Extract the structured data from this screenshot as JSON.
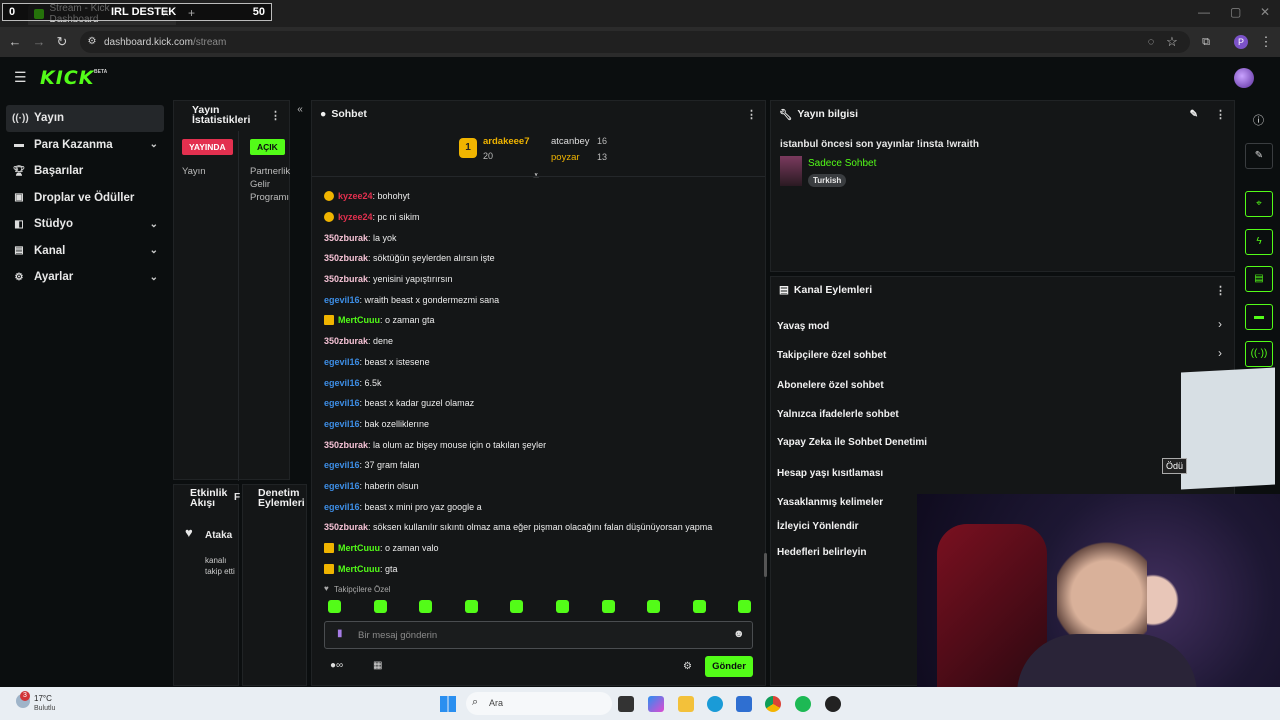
{
  "browser": {
    "tab_title": "Stream - Kick Dashboard",
    "url_domain": "dashboard.kick.com",
    "url_path": "/stream",
    "overlay_left": "0",
    "overlay_title": "IRL DESTEK",
    "overlay_count": "50",
    "profile_initial": "P"
  },
  "sidebar": {
    "items": [
      {
        "label": "Yayın",
        "icon": "broadcast-icon"
      },
      {
        "label": "Para Kazanma",
        "icon": "money-icon"
      },
      {
        "label": "Başarılar",
        "icon": "trophy-icon"
      },
      {
        "label": "Droplar ve Ödüller",
        "icon": "gift-icon"
      },
      {
        "label": "Stüdyo",
        "icon": "studio-icon"
      },
      {
        "label": "Kanal",
        "icon": "channel-icon"
      },
      {
        "label": "Ayarlar",
        "icon": "gear-icon"
      }
    ]
  },
  "stats_panel": {
    "title": "Yayın İstatistikleri",
    "live_badge": "YAYINDA",
    "open_badge": "AÇIK",
    "col1_label": "Yayın",
    "col2_label": "Partnerlik Gelir Programı"
  },
  "activity_panel": {
    "title": "Etkinlik Akışı",
    "item_title": "Ataka",
    "item_text": "kanalı takip etti",
    "side_letter": "F"
  },
  "moderation_panel": {
    "title": "Denetim Eylemleri"
  },
  "chat": {
    "title": "Sohbet",
    "top": [
      {
        "rank": "1",
        "name": "ardakeee7",
        "count": "20"
      },
      {
        "rank": "2",
        "name": "atcanbey",
        "count": "16"
      },
      {
        "rank": "3",
        "name": "poyzar",
        "count": "13"
      }
    ],
    "messages": [
      {
        "user": "kyzee24",
        "text": ": bohohyt",
        "color": "#e3304f",
        "icon": "gold"
      },
      {
        "user": "kyzee24",
        "text": ": pc ni sikim",
        "color": "#e3304f",
        "icon": "gold"
      },
      {
        "user": "350zburak",
        "text": ": la yok",
        "color": "#f5c2d5",
        "icon": ""
      },
      {
        "user": "350zburak",
        "text": ": söktüğün şeylerden alırsın işte",
        "color": "#f5c2d5",
        "icon": ""
      },
      {
        "user": "350zburak",
        "text": ": yenisini yapıştırırsın",
        "color": "#f5c2d5",
        "icon": ""
      },
      {
        "user": "egevil16",
        "text": ": wraith beast x gondermezmi sana",
        "color": "#3d8ee6",
        "icon": ""
      },
      {
        "user": "MertCuuu",
        "text": ": o zaman gta",
        "color": "#53fc18",
        "icon": "crown"
      },
      {
        "user": "350zburak",
        "text": ": dene",
        "color": "#f5c2d5",
        "icon": ""
      },
      {
        "user": "egevil16",
        "text": ": beast x istesene",
        "color": "#3d8ee6",
        "icon": ""
      },
      {
        "user": "egevil16",
        "text": ": 6.5k",
        "color": "#3d8ee6",
        "icon": ""
      },
      {
        "user": "egevil16",
        "text": ": beast x kadar guzel olamaz",
        "color": "#3d8ee6",
        "icon": ""
      },
      {
        "user": "egevil16",
        "text": ": bak ozelliklerıne",
        "color": "#3d8ee6",
        "icon": ""
      },
      {
        "user": "350zburak",
        "text": ": la olum az bişey mouse için o takılan şeyler",
        "color": "#f5c2d5",
        "icon": ""
      },
      {
        "user": "egevil16",
        "text": ": 37 gram falan",
        "color": "#3d8ee6",
        "icon": ""
      },
      {
        "user": "egevil16",
        "text": ": haberin olsun",
        "color": "#3d8ee6",
        "icon": ""
      },
      {
        "user": "egevil16",
        "text": ": beast x mini pro yaz google a",
        "color": "#3d8ee6",
        "icon": ""
      },
      {
        "user": "350zburak",
        "text": ": söksen kullanılır sıkıntı olmaz ama eğer pişman olacağını falan düşünüyorsan yapma",
        "color": "#f5c2d5",
        "icon": ""
      },
      {
        "user": "MertCuuu",
        "text": ": o zaman valo",
        "color": "#53fc18",
        "icon": "crown"
      },
      {
        "user": "MertCuuu",
        "text": ": gta",
        "color": "#53fc18",
        "icon": "crown"
      }
    ],
    "followers_only": "Takipçilere Özel",
    "input_placeholder": "Bir mesaj gönderin",
    "send_label": "Gönder"
  },
  "stream_info": {
    "title": "Yayın bilgisi",
    "stream_title": "istanbul öncesi son yayınlar !insta !wraith",
    "category": "Sadece Sohbet",
    "language": "Turkish"
  },
  "channel_actions": {
    "title": "Kanal Eylemleri",
    "items": [
      "Yavaş mod",
      "Takipçilere özel sohbet",
      "Abonelere özel sohbet",
      "Yalnızca ifadelerle sohbet",
      "Yapay Zeka ile Sohbet Denetimi",
      "Hesap yaşı kısıtlaması",
      "Yasaklanmış kelimeler",
      "İzleyici Yönlendir",
      "Hedefleri belirleyin"
    ]
  },
  "overlay_snippet": "Ödü",
  "taskbar": {
    "temp": "17°C",
    "weather": "Bulutlu",
    "notif_count": "3",
    "search_label": "Ara"
  },
  "colors": {
    "accent": "#53fc18",
    "live": "#e3304f"
  }
}
